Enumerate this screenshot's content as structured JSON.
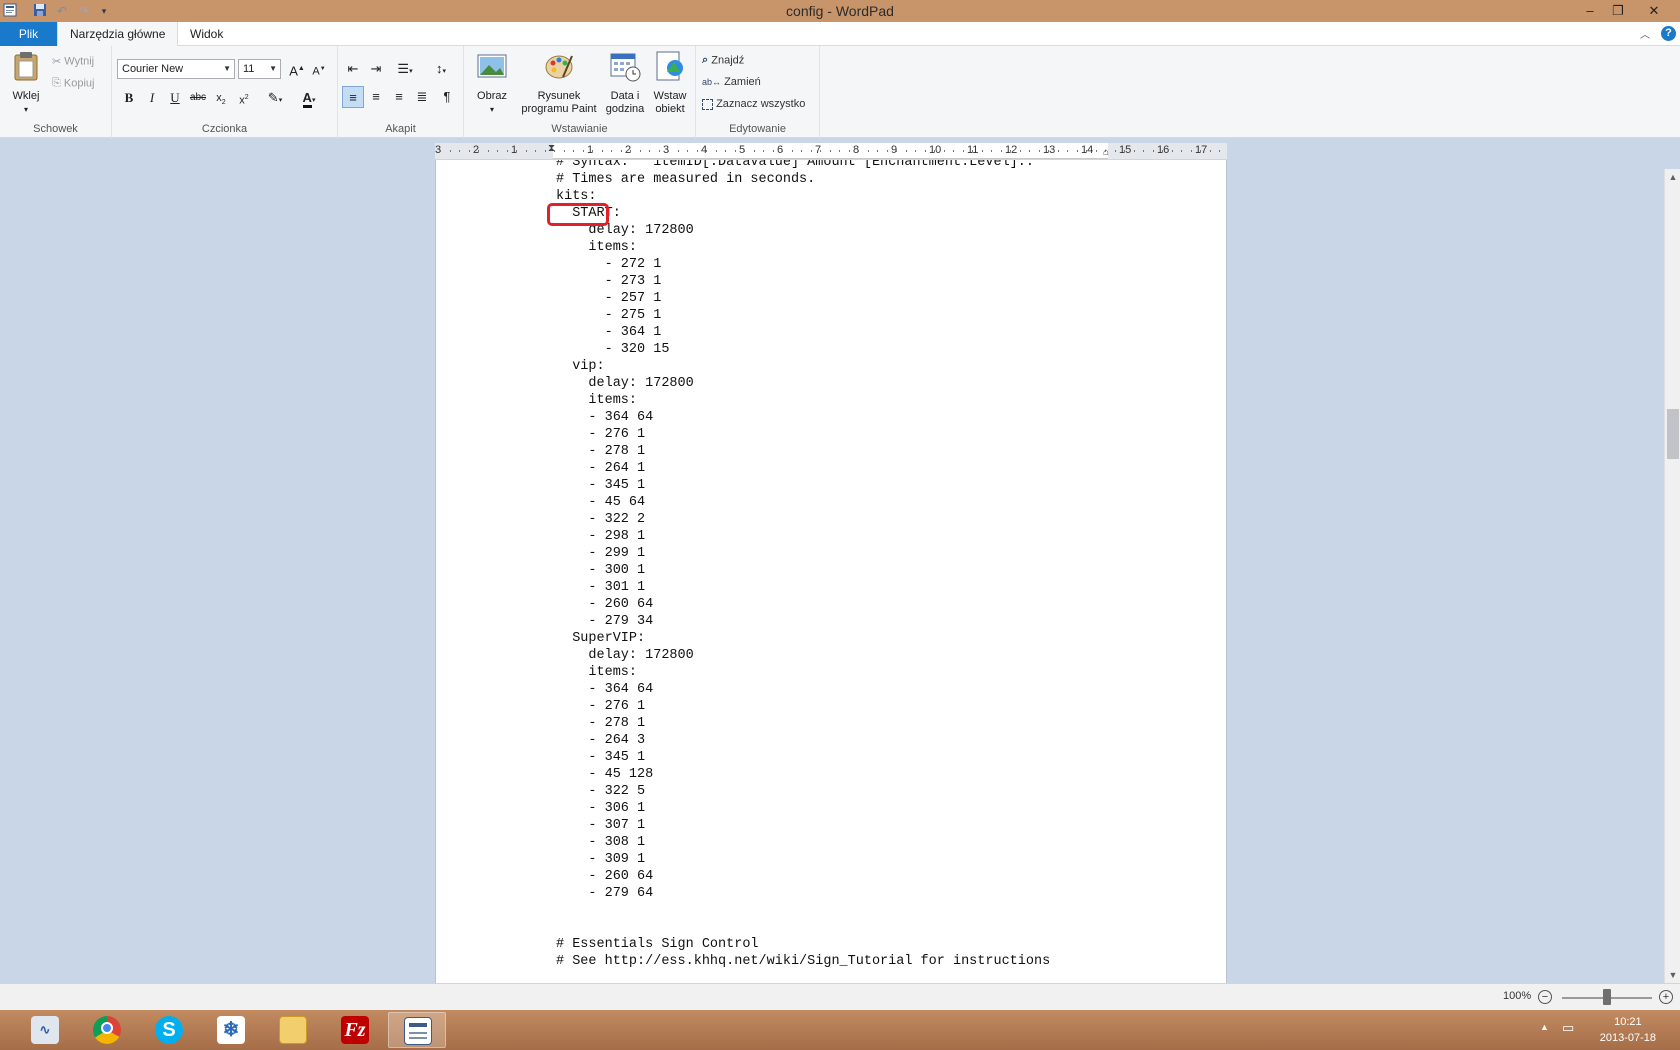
{
  "window": {
    "title": "config - WordPad"
  },
  "tabs": {
    "file": "Plik",
    "home": "Narzędzia główne",
    "view": "Widok"
  },
  "ribbon": {
    "clipboard": {
      "label": "Schowek",
      "paste": "Wklej",
      "cut": "Wytnij",
      "copy": "Kopiuj"
    },
    "font": {
      "label": "Czcionka",
      "family": "Courier New",
      "size": "11"
    },
    "paragraph": {
      "label": "Akapit"
    },
    "insert": {
      "label": "Wstawianie",
      "picture": "Obraz",
      "paint_line1": "Rysunek",
      "paint_line2": "programu Paint",
      "datetime_line1": "Data i",
      "datetime_line2": "godzina",
      "object_line1": "Wstaw",
      "object_line2": "obiekt"
    },
    "editing": {
      "label": "Edytowanie",
      "find": "Znajdź",
      "replace": "Zamień",
      "select_all": "Zaznacz wszystko"
    }
  },
  "ruler": {
    "marks": [
      "3",
      "2",
      "1",
      "1",
      "2",
      "3",
      "4",
      "5",
      "6",
      "7",
      "8",
      "9",
      "10",
      "11",
      "12",
      "13",
      "14",
      "15",
      "16",
      "17"
    ]
  },
  "document": {
    "lines": [
      "# Syntax:   itemID[:DataValue] Amount [Enchantment:Level]..",
      "# Times are measured in seconds.",
      "kits:",
      "  START:",
      "    delay: 172800",
      "    items:",
      "      - 272 1",
      "      - 273 1",
      "      - 257 1",
      "      - 275 1",
      "      - 364 1",
      "      - 320 15",
      "  vip:",
      "    delay: 172800",
      "    items:",
      "    - 364 64",
      "    - 276 1",
      "    - 278 1",
      "    - 264 1",
      "    - 345 1",
      "    - 45 64",
      "    - 322 2",
      "    - 298 1",
      "    - 299 1",
      "    - 300 1",
      "    - 301 1",
      "    - 260 64",
      "    - 279 34",
      "  SuperVIP:",
      "    delay: 172800",
      "    items:",
      "    - 364 64",
      "    - 276 1",
      "    - 278 1",
      "    - 264 3",
      "    - 345 1",
      "    - 45 128",
      "    - 322 5",
      "    - 306 1",
      "    - 307 1",
      "    - 308 1",
      "    - 309 1",
      "    - 260 64",
      "    - 279 64",
      "",
      "",
      "# Essentials Sign Control",
      "# See http://ess.khhq.net/wiki/Sign_Tutorial for instructions"
    ]
  },
  "statusbar": {
    "zoom": "100%",
    "zoom_level": 1.0
  },
  "taskbar": {
    "apps": [
      "resource-monitor",
      "chrome",
      "skype",
      "snowflake-app",
      "file-explorer",
      "filezilla",
      "wordpad"
    ],
    "time": "10:21",
    "date": "2013-07-18"
  },
  "colors": {
    "file_tab": "#1979ca",
    "titlebar": "#c8956a",
    "highlight": "#e0202a",
    "taskbar": "#b37b52"
  }
}
